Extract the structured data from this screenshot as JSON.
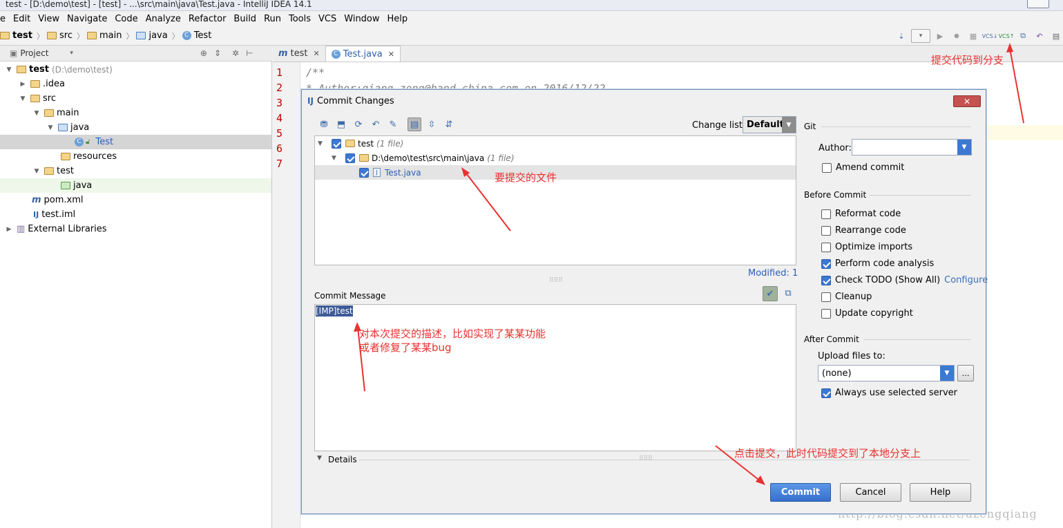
{
  "window": {
    "title": "test - [D:\\demo\\test] - [test] - ...\\src\\main\\java\\Test.java - IntelliJ IDEA 14.1"
  },
  "menu": [
    "e",
    "Edit",
    "View",
    "Navigate",
    "Code",
    "Analyze",
    "Refactor",
    "Build",
    "Run",
    "Tools",
    "VCS",
    "Window",
    "Help"
  ],
  "breadcrumb": [
    "test",
    "src",
    "main",
    "java",
    "Test"
  ],
  "project_panel": {
    "header": "Project",
    "tree": [
      {
        "label": "test",
        "extra": "(D:\\demo\\test)"
      },
      {
        "label": ".idea"
      },
      {
        "label": "src"
      },
      {
        "label": "main"
      },
      {
        "label": "java"
      },
      {
        "label": "Test"
      },
      {
        "label": "resources"
      },
      {
        "label": "test"
      },
      {
        "label": "java"
      },
      {
        "label": "pom.xml"
      },
      {
        "label": "test.iml"
      },
      {
        "label": "External Libraries"
      }
    ]
  },
  "editor": {
    "tabs": [
      {
        "label": "test",
        "prefix": "m"
      },
      {
        "label": "Test.java",
        "prefix": "C"
      }
    ],
    "line_numbers": [
      "1",
      "2",
      "3",
      "4",
      "5",
      "6",
      "7"
    ],
    "lines": [
      "/**",
      "* Author:qiang.zeng@hand-china.com on 2016/12/22"
    ]
  },
  "dialog": {
    "title": "Commit Changes",
    "change_list_label": "Change list:",
    "change_list_value": "Default",
    "git_label": "Git",
    "files": [
      {
        "label": "test",
        "note": "(1 file)"
      },
      {
        "label": "D:\\demo\\test\\src\\main\\java",
        "note": "(1 file)"
      },
      {
        "label": "Test.java",
        "note": ""
      }
    ],
    "modified": "Modified: 1",
    "commit_message_label": "Commit Message",
    "commit_message": "[IMP]test",
    "details_label": "Details",
    "author_label": "Author:",
    "author_value": "",
    "amend_label": "Amend commit",
    "before_commit_label": "Before Commit",
    "before_commit_options": [
      {
        "label": "Reformat code",
        "checked": false
      },
      {
        "label": "Rearrange code",
        "checked": false
      },
      {
        "label": "Optimize imports",
        "checked": false
      },
      {
        "label": "Perform code analysis",
        "checked": true
      },
      {
        "label": "Check TODO (Show All)",
        "checked": true
      },
      {
        "label": "Cleanup",
        "checked": false
      },
      {
        "label": "Update copyright",
        "checked": false
      }
    ],
    "configure_link": "Configure",
    "after_commit_label": "After Commit",
    "upload_label": "Upload files to:",
    "upload_value": "(none)",
    "always_use_label": "Always use selected server",
    "buttons": {
      "commit": "Commit",
      "cancel": "Cancel",
      "help": "Help"
    }
  },
  "annotations": {
    "commit_to_branch": "提交代码到分支",
    "files_to_commit": "要提交的文件",
    "message_desc_1": "对本次提交的描述，比如实现了某某功能",
    "message_desc_2": "或者修复了某某bug",
    "click_commit": "点击提交，此时代码提交到了本地分支上"
  },
  "watermark": "http://blog.csdn.net/azengqiang",
  "colors": {
    "accent": "#3c79d3",
    "annotation": "#e8312f",
    "error_gutter": "#c00000"
  }
}
